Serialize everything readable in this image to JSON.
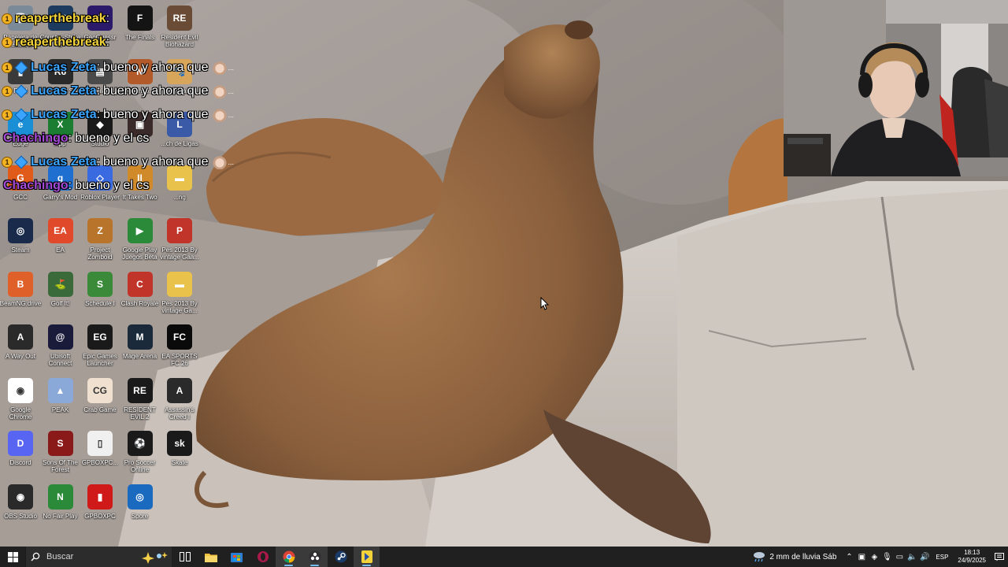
{
  "desktop": {
    "icons": [
      {
        "label": "Papelera de reciclaje",
        "icon": "recycle-bin-icon",
        "color": "#7b8a98",
        "glyph": "🗑"
      },
      {
        "label": "Counter-Strike 2",
        "icon": "counter-strike-icon",
        "color": "#1d3a5f",
        "glyph": "CS"
      },
      {
        "label": "GeoGuessr",
        "icon": "geoguessr-icon",
        "color": "#2b1a6a",
        "glyph": "G"
      },
      {
        "label": "The Finals",
        "icon": "the-finals-icon",
        "color": "#141414",
        "glyph": "F"
      },
      {
        "label": "Resident Evil Biohazard",
        "icon": "resident-evil-icon",
        "color": "#6a4c36",
        "glyph": "RE"
      },
      {
        "label": "Final",
        "icon": "final-icon",
        "color": "#3a3a3a",
        "glyph": "▮"
      },
      {
        "label": "Rainbow Six",
        "icon": "rainbow-six-icon",
        "color": "#2a2a2a",
        "glyph": "R6"
      },
      {
        "label": "Simulator",
        "icon": "simulator-icon",
        "color": "#4a4a4a",
        "glyph": "▤"
      },
      {
        "label": "Neighbo...",
        "icon": "neighbor-icon",
        "color": "#b35a2a",
        "glyph": "N"
      },
      {
        "label": "Animals",
        "icon": "animals-icon",
        "color": "#d7a65b",
        "glyph": "🐾"
      },
      {
        "label": "Edge",
        "icon": "edge-icon",
        "color": "#1b8fd6",
        "glyph": "e"
      },
      {
        "label": "App",
        "icon": "xbox-app-icon",
        "color": "#1a7d32",
        "glyph": "X"
      },
      {
        "label": "Studio",
        "icon": "roblox-studio-icon",
        "color": "#1a1a1a",
        "glyph": "◆"
      },
      {
        "label": "",
        "icon": "game-icon",
        "color": "#3a2a2a",
        "glyph": "▣"
      },
      {
        "label": "...ch de Ligas",
        "icon": "ligas-icon",
        "color": "#3a5aa8",
        "glyph": "L"
      },
      {
        "label": "GCC",
        "icon": "gcc-icon",
        "color": "#e05a1a",
        "glyph": "G"
      },
      {
        "label": "Garry's Mod",
        "icon": "garrys-mod-icon",
        "color": "#1e6fd0",
        "glyph": "g"
      },
      {
        "label": "Roblox Player",
        "icon": "roblox-player-icon",
        "color": "#3a6ae0",
        "glyph": "◇"
      },
      {
        "label": "It Takes Two",
        "icon": "it-takes-two-icon",
        "color": "#d08a2a",
        "glyph": "II"
      },
      {
        "label": "...ng",
        "icon": "folder-icon",
        "color": "#e8c24a",
        "glyph": "▬"
      },
      {
        "label": "Steam",
        "icon": "steam-icon",
        "color": "#1a2a4a",
        "glyph": "◎"
      },
      {
        "label": "EA",
        "icon": "ea-icon",
        "color": "#e04a2a",
        "glyph": "EA"
      },
      {
        "label": "Project Zomboid",
        "icon": "project-zomboid-icon",
        "color": "#b8742a",
        "glyph": "Z"
      },
      {
        "label": "Google Play Juegos Beta",
        "icon": "google-play-games-icon",
        "color": "#2a8a3a",
        "glyph": "▶"
      },
      {
        "label": "Pes 2013 By vintage Gaa...",
        "icon": "pes-2013-icon",
        "color": "#c0342a",
        "glyph": "P"
      },
      {
        "label": "BeamNG.drive",
        "icon": "beamng-icon",
        "color": "#e0602a",
        "glyph": "B"
      },
      {
        "label": "Golf It!",
        "icon": "golf-it-icon",
        "color": "#3a6a3a",
        "glyph": "⛳"
      },
      {
        "label": "Schedule I",
        "icon": "schedule-one-icon",
        "color": "#3a8a3a",
        "glyph": "S"
      },
      {
        "label": "Clash Royale",
        "icon": "clash-royale-icon",
        "color": "#c0342a",
        "glyph": "C"
      },
      {
        "label": "Pes 2013 By vintage Ga...",
        "icon": "folder-icon",
        "color": "#e8c24a",
        "glyph": "▬"
      },
      {
        "label": "A Way Out",
        "icon": "a-way-out-icon",
        "color": "#2a2a2a",
        "glyph": "A"
      },
      {
        "label": "Ubisoft Connect",
        "icon": "ubisoft-connect-icon",
        "color": "#1a1a3a",
        "glyph": "@"
      },
      {
        "label": "Epic Games Launcher",
        "icon": "epic-games-icon",
        "color": "#1a1a1a",
        "glyph": "EG"
      },
      {
        "label": "Mage Arena",
        "icon": "mage-arena-icon",
        "color": "#1a2a3a",
        "glyph": "M"
      },
      {
        "label": "EA SPORTS FC 26",
        "icon": "ea-sports-fc-icon",
        "color": "#0a0a0a",
        "glyph": "FC"
      },
      {
        "label": "Google Chrome",
        "icon": "chrome-icon",
        "color": "#ffffff",
        "glyph": "◉"
      },
      {
        "label": "PEAK",
        "icon": "peak-icon",
        "color": "#8aa8d8",
        "glyph": "▲"
      },
      {
        "label": "Crab Game",
        "icon": "crab-game-icon",
        "color": "#f0e0d0",
        "glyph": "CG"
      },
      {
        "label": "RESIDENT EVIL 2",
        "icon": "resident-evil-2-icon",
        "color": "#1a1a1a",
        "glyph": "RE"
      },
      {
        "label": "Assassin's Creed I",
        "icon": "assassins-creed-icon",
        "color": "#2a2a2a",
        "glyph": "A"
      },
      {
        "label": "Discord",
        "icon": "discord-icon",
        "color": "#5865f2",
        "glyph": "D"
      },
      {
        "label": "Sons Of The Forest",
        "icon": "sons-of-the-forest-icon",
        "color": "#8a1a1a",
        "glyph": "S"
      },
      {
        "label": "GPBOXPC...",
        "icon": "file-icon",
        "color": "#f0f0f0",
        "glyph": "▯"
      },
      {
        "label": "Pro Soccer Online",
        "icon": "pro-soccer-online-icon",
        "color": "#1a1a1a",
        "glyph": "⚽"
      },
      {
        "label": "Skate",
        "icon": "skate-icon",
        "color": "#1a1a1a",
        "glyph": "sk"
      },
      {
        "label": "OBS Studio",
        "icon": "obs-studio-icon",
        "color": "#2a2a2a",
        "glyph": "◉"
      },
      {
        "label": "No Fair Play",
        "icon": "no-fair-play-icon",
        "color": "#2a8a3a",
        "glyph": "N"
      },
      {
        "label": "GPBOXPC",
        "icon": "gpboxpc-icon",
        "color": "#d01a1a",
        "glyph": "▮"
      },
      {
        "label": "Spore",
        "icon": "spore-icon",
        "color": "#1a6ac0",
        "glyph": "◎"
      }
    ]
  },
  "chat": {
    "emote_dots": "...",
    "lines": [
      {
        "name": "reaperthebreak",
        "suffix": ":",
        "text": "",
        "color": "#f3d33a",
        "badge": true,
        "badge2": false,
        "emote": false
      },
      {
        "name": "reaperthebreak",
        "suffix": ":",
        "text": "",
        "color": "#f3d33a",
        "badge": true,
        "badge2": false,
        "emote": false
      },
      {
        "name": "Lucas Zeta",
        "suffix": ":",
        "text": "bueno y ahora que",
        "color": "#3aa4ff",
        "badge": true,
        "badge2": true,
        "emote": true
      },
      {
        "name": "Lucas Zeta",
        "suffix": ":",
        "text": "bueno y ahora que",
        "color": "#3aa4ff",
        "badge": true,
        "badge2": true,
        "emote": true
      },
      {
        "name": "Lucas Zeta",
        "suffix": ":",
        "text": "bueno y ahora que",
        "color": "#3aa4ff",
        "badge": true,
        "badge2": true,
        "emote": true
      },
      {
        "name": "Chachingo",
        "suffix": ":",
        "text": "bueno y el cs",
        "color": "#a64bd8",
        "badge": false,
        "badge2": false,
        "emote": false
      },
      {
        "name": "Lucas Zeta",
        "suffix": ":",
        "text": "bueno y ahora que",
        "color": "#3aa4ff",
        "badge": true,
        "badge2": true,
        "emote": true
      },
      {
        "name": "Chachingo",
        "suffix": ":",
        "text": "bueno y el cs",
        "color": "#a64bd8",
        "badge": false,
        "badge2": false,
        "emote": false
      }
    ]
  },
  "taskbar": {
    "search_placeholder": "Buscar",
    "apps": [
      {
        "icon": "task-view-icon",
        "active": false
      },
      {
        "icon": "file-explorer-icon",
        "active": false
      },
      {
        "icon": "microsoft-store-icon",
        "active": false
      },
      {
        "icon": "opera-gx-icon",
        "active": false
      },
      {
        "icon": "chrome-icon",
        "active": true
      },
      {
        "icon": "obs-studio-icon",
        "active": true
      },
      {
        "icon": "steam-icon",
        "active": false
      },
      {
        "icon": "app-icon",
        "active": true
      }
    ],
    "weather": "2 mm de lluvia Sáb",
    "language": "ESP",
    "time": "18:13",
    "date": "24/9/2025"
  },
  "colors": {
    "taskbar_bg": "#202020",
    "accent": "#76b9ed"
  }
}
